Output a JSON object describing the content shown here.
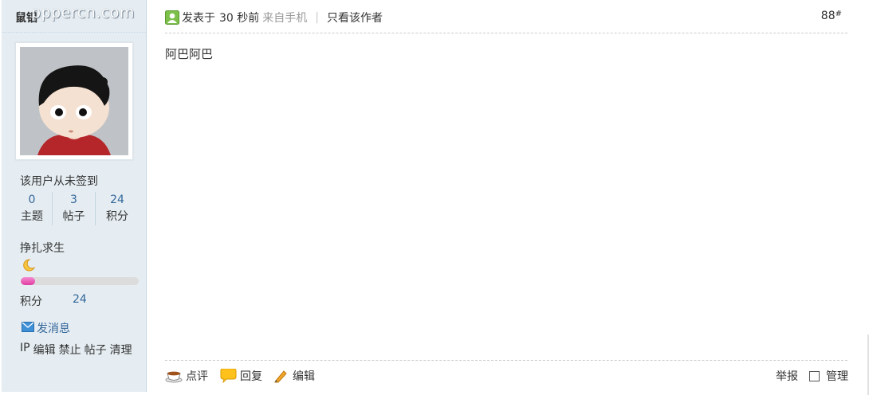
{
  "author": {
    "username": "鼠铝",
    "watermark": "pppercn.com"
  },
  "profile": {
    "sign_status": "该用户从未签到",
    "stats": [
      {
        "value": "0",
        "label": "主题"
      },
      {
        "value": "3",
        "label": "帖子"
      },
      {
        "value": "24",
        "label": "积分"
      }
    ],
    "rank_title": "挣扎求生",
    "rank_icon": "moon-icon",
    "progress_fraction": 0.12,
    "points_label": "积分",
    "points_value": "24",
    "send_message": "发消息",
    "admin_links": [
      "IP",
      "编辑",
      "禁止",
      "帖子",
      "清理"
    ]
  },
  "post": {
    "posted_label": "发表于",
    "posted_time": "30 秒前",
    "source": "来自手机",
    "separator": "|",
    "author_only": "只看该作者",
    "floor_number": "88",
    "floor_mark": "#",
    "content": "阿巴阿巴"
  },
  "actions": {
    "comment": "点评",
    "reply": "回复",
    "edit": "编辑",
    "report": "举报",
    "manage": "管理"
  },
  "colors": {
    "sidebar_bg": "#e5edf2",
    "link_blue": "#336699",
    "progress_pink": "#e03ba2"
  }
}
